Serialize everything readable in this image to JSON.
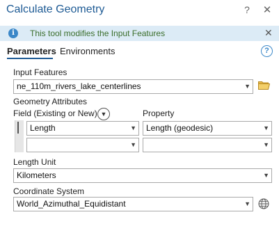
{
  "dialog": {
    "title": "Calculate Geometry",
    "help_label": "?",
    "close_label": "✕"
  },
  "banner": {
    "icon": "info-icon",
    "message": "This tool modifies the Input Features",
    "close_label": "✕"
  },
  "tabs": [
    {
      "label": "Parameters",
      "active": true
    },
    {
      "label": "Environments",
      "active": false
    }
  ],
  "form": {
    "input_features": {
      "label": "Input Features",
      "value": "ne_110m_rivers_lake_centerlines"
    },
    "geometry_attributes": {
      "label": "Geometry Attributes",
      "field_header": "Field (Existing or New)",
      "property_header": "Property",
      "rows": [
        {
          "field": "Length",
          "property": "Length (geodesic)"
        },
        {
          "field": "",
          "property": ""
        }
      ]
    },
    "length_unit": {
      "label": "Length Unit",
      "value": "Kilometers"
    },
    "coordinate_system": {
      "label": "Coordinate System",
      "value": "World_Azimuthal_Equidistant"
    }
  },
  "colors": {
    "title": "#1d5a94",
    "banner_bg": "#dcebf6",
    "banner_text": "#3b6e2c",
    "accent": "#3a87c8"
  }
}
